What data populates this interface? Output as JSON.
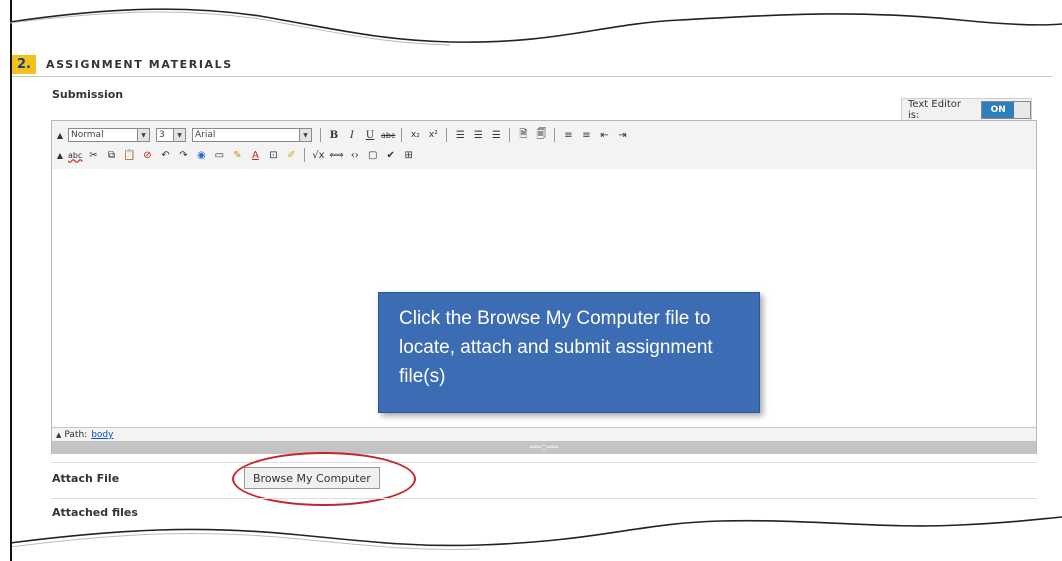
{
  "section": {
    "number": "2.",
    "title": "ASSIGNMENT MATERIALS"
  },
  "submission_label": "Submission",
  "text_editor": {
    "label": "Text Editor is:",
    "state": "ON"
  },
  "toolbar": {
    "format_select": "Normal",
    "size_select": "3",
    "font_select": "Arial",
    "bold": "B",
    "italic": "I",
    "underline": "U",
    "strike": "abc",
    "subscript": "x₂",
    "superscript": "x²",
    "spellcheck": "abc"
  },
  "path": {
    "label": "Path:",
    "value": "body"
  },
  "callout": {
    "text": "Click the Browse My Computer file to locate, attach and submit assignment file(s)"
  },
  "attach": {
    "label": "Attach File",
    "button": "Browse My Computer"
  },
  "attached_files_label": "Attached files",
  "colors": {
    "accent_blue": "#3b6cb4",
    "highlight_red": "#c0262a",
    "section_yellow": "#f2c21b",
    "toggle_on": "#2c7fb8"
  }
}
